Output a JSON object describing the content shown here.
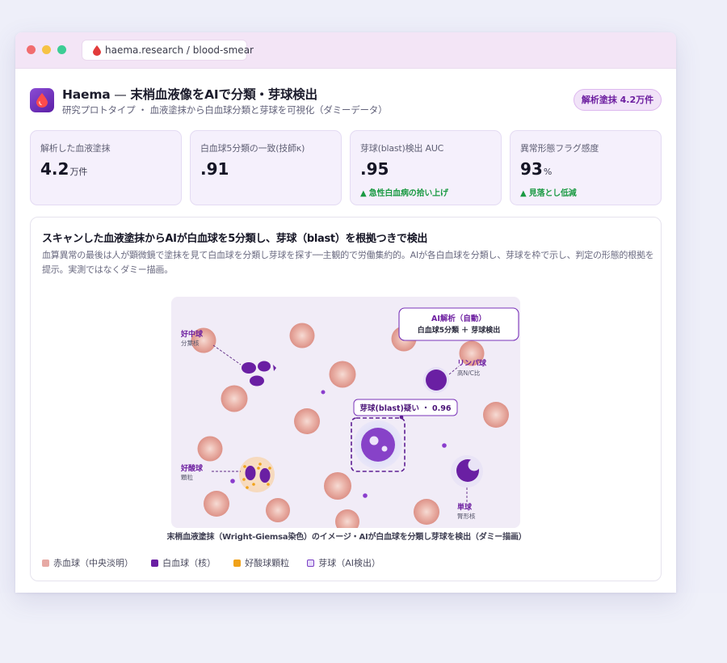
{
  "browser": {
    "url": "haema.research / blood-smear"
  },
  "header": {
    "app_name": "Haema",
    "separator": " — ",
    "title": "末梢血液像をAIで分類・芽球検出",
    "subtitle": "研究プロトタイプ ・ 血液塗抹から白血球分類と芽球を可視化（ダミーデータ）",
    "badge": "解析塗抹 4.2万件"
  },
  "stats": [
    {
      "label": "解析した血液塗抹",
      "value": "4.2",
      "unit": "万件",
      "delta": ""
    },
    {
      "label": "白血球5分類の一致(技師κ)",
      "value": ".91",
      "unit": "",
      "delta": ""
    },
    {
      "label": "芽球(blast)検出 AUC",
      "value": ".95",
      "unit": "",
      "delta": "▲ 急性白血病の拾い上げ"
    },
    {
      "label": "異常形態フラグ感度",
      "value": "93",
      "unit": "%",
      "delta": "▲ 見落とし低減"
    }
  ],
  "panel": {
    "title": "スキャンした血液塗抹からAIが白血球を5分類し、芽球（blast）を根拠つきで検出",
    "description": "血算異常の最後は人が顕微鏡で塗抹を見て白血球を分類し芽球を探す──主観的で労働集約的。AIが各白血球を分類し、芽球を枠で示し、判定の形態的根拠を提示。実測ではなくダミー描画。",
    "caption": "末梢血液塗抹（Wright-Giemsa染色）のイメージ・AIが白血球を分類し芽球を検出（ダミー描画）"
  },
  "smear": {
    "ai_box_title": "AI解析（自動）",
    "ai_box_sub": "白血球5分類 ＋ 芽球検出",
    "blast_label": "芽球(blast)疑い ・ 0.96",
    "neutrophil": {
      "name": "好中球",
      "sub": "分葉核"
    },
    "lymphocyte": {
      "name": "リンパ球",
      "sub": "高N/C比"
    },
    "eosinophil": {
      "name": "好酸球",
      "sub": "顆粒"
    },
    "monocyte": {
      "name": "単球",
      "sub": "腎形核"
    }
  },
  "legend": [
    {
      "key": "rbc",
      "label": "赤血球（中央淡明）"
    },
    {
      "key": "wbc",
      "label": "白血球（核）"
    },
    {
      "key": "eos",
      "label": "好酸球顆粒"
    },
    {
      "key": "blast",
      "label": "芽球（AI検出）"
    }
  ],
  "colors": {
    "accent": "#6d1fa0",
    "rbc": "#e6a9a4",
    "nucleus": "#6a1fa3",
    "granule": "#f0a21a",
    "positive": "#1b9a43"
  }
}
